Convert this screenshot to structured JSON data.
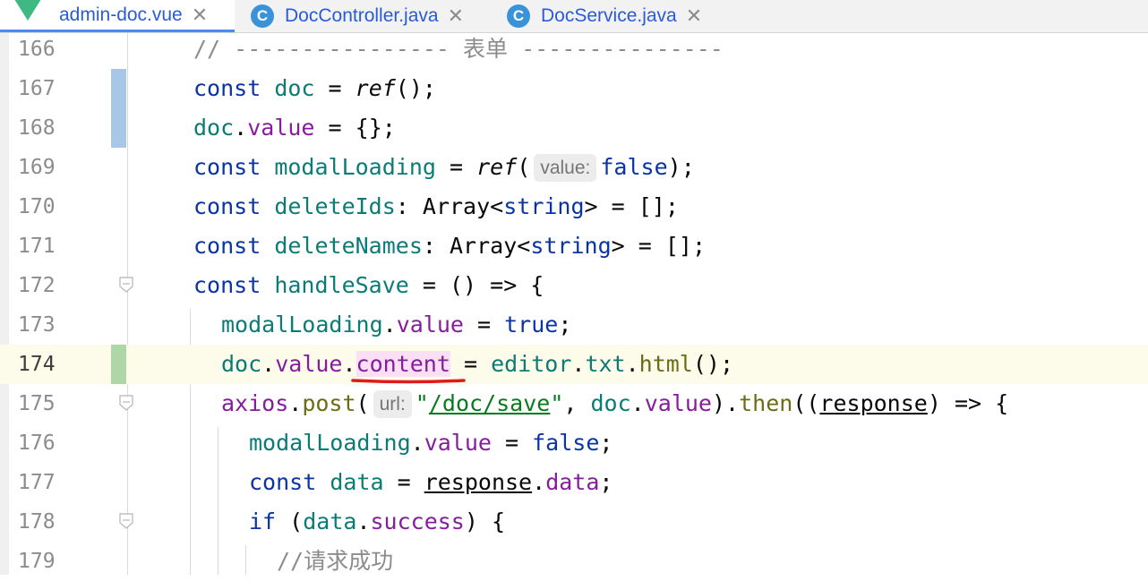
{
  "tabs": [
    {
      "label": "admin-doc.vue",
      "icon": "vue-icon",
      "active": true
    },
    {
      "label": "DocController.java",
      "icon": "class-icon",
      "active": false
    },
    {
      "label": "DocService.java",
      "icon": "class-icon",
      "active": false
    }
  ],
  "tab_close_glyph": "✕",
  "class_icon_letter": "C",
  "lines": [
    {
      "num": "166"
    },
    {
      "num": "167"
    },
    {
      "num": "168"
    },
    {
      "num": "169"
    },
    {
      "num": "170"
    },
    {
      "num": "171"
    },
    {
      "num": "172"
    },
    {
      "num": "173"
    },
    {
      "num": "174"
    },
    {
      "num": "175"
    },
    {
      "num": "176"
    },
    {
      "num": "177"
    },
    {
      "num": "178"
    },
    {
      "num": "179"
    }
  ],
  "code": {
    "l166": {
      "comment": "// ---------------- 表单 ---------------"
    },
    "l167": {
      "kw": "const",
      "name": "doc",
      "eq": " = ",
      "fn": "ref",
      "tail": "();"
    },
    "l168": {
      "obj": "doc",
      "dot": ".",
      "prop": "value",
      "tail": " = {};"
    },
    "l169": {
      "kw": "const",
      "name": "modalLoading",
      "eq": " = ",
      "fn": "ref",
      "open": "(",
      "hint": "value:",
      "val": "false",
      "tail": ");"
    },
    "l170": {
      "kw": "const",
      "name": "deleteIds",
      "colon": ": Array<",
      "type": "string",
      "tail": "> = [];"
    },
    "l171": {
      "kw": "const",
      "name": "deleteNames",
      "colon": ": Array<",
      "type": "string",
      "tail": "> = [];"
    },
    "l172": {
      "kw": "const",
      "name": "handleSave",
      "tail": " = () => {"
    },
    "l173": {
      "obj": "modalLoading",
      "dot": ".",
      "prop": "value",
      "eq": " = ",
      "val": "true",
      "tail": ";"
    },
    "l174": {
      "obj": "doc",
      "dot": ".",
      "prop": "value",
      "dot2": ".",
      "prop2": "content",
      "eq": " = ",
      "obj2": "editor",
      "dot3": ".",
      "prop3": "txt",
      "dot4": ".",
      "fn": "html",
      "tail": "();"
    },
    "l175": {
      "obj": "axios",
      "dot": ".",
      "fn": "post",
      "open": "(",
      "hint": "url:",
      "q1": "\"",
      "str": "/doc/save",
      "q2": "\"",
      "comma": ", ",
      "obj2": "doc",
      "dot2": ".",
      "prop": "value",
      "close": ").",
      "fn2": "then",
      "open2": "((",
      "param": "response",
      "tail": ") => {"
    },
    "l176": {
      "obj": "modalLoading",
      "dot": ".",
      "prop": "value",
      "eq": " = ",
      "val": "false",
      "tail": ";"
    },
    "l177": {
      "kw": "const",
      "name": "data",
      "eq": " = ",
      "obj": "response",
      "dot": ".",
      "prop": "data",
      "tail": ";"
    },
    "l178": {
      "kw": "if",
      "open": " (",
      "obj": "data",
      "dot": ".",
      "prop": "success",
      "tail": ") {"
    },
    "l179": {
      "comment": "//请求成功"
    }
  },
  "colors": {
    "keyword": "#0a34a6",
    "variable": "#0b7b76",
    "property": "#861d9d",
    "function": "#6c6c17",
    "string": "#0a7a1f",
    "comment": "#8c8c8c",
    "error_underline": "#e01b1b",
    "current_line": "#fdfbe9"
  }
}
